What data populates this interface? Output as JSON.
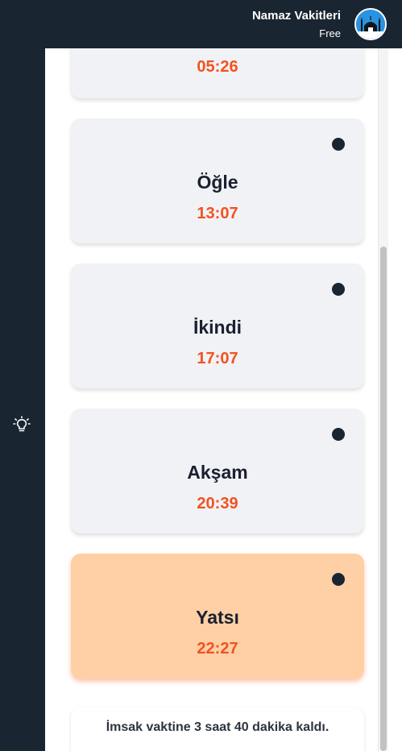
{
  "header": {
    "title": "Namaz Vakitleri",
    "plan": "Free"
  },
  "sidebar": {
    "icon": "lightbulb-icon"
  },
  "prayers": [
    {
      "name": "",
      "time": "05:26",
      "active": false
    },
    {
      "name": "Öğle",
      "time": "13:07",
      "active": false
    },
    {
      "name": "İkindi",
      "time": "17:07",
      "active": false
    },
    {
      "name": "Akşam",
      "time": "20:39",
      "active": false
    },
    {
      "name": "Yatsı",
      "time": "22:27",
      "active": true
    }
  ],
  "footer": {
    "remaining_text": "İmsak vaktine 3 saat 40 dakika kaldı."
  },
  "colors": {
    "sidebar": "#1a2532",
    "card": "#f1f2f6",
    "active_card": "#ffd0a5",
    "time": "#f2521f"
  }
}
